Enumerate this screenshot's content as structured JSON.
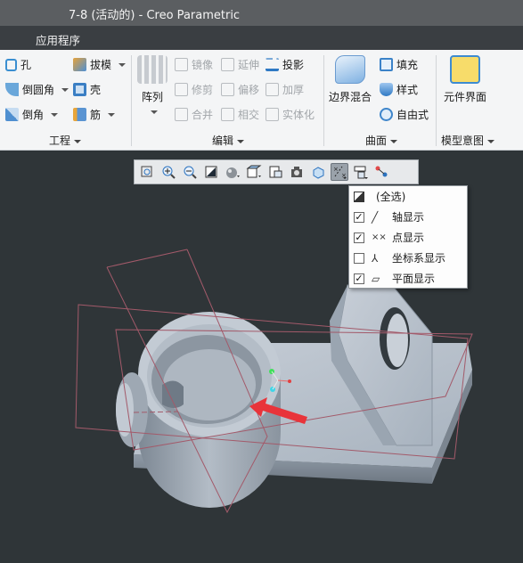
{
  "window": {
    "title": "7-8 (活动的) - Creo Parametric"
  },
  "menubar": {
    "applications": "应用程序"
  },
  "ribbon": {
    "engineering": {
      "hole": "孔",
      "draft": "拔模",
      "round": "倒圆角",
      "shell": "壳",
      "chamfer": "倒角",
      "rib": "筋",
      "group_label": "工程"
    },
    "editing": {
      "pattern": "阵列",
      "mirror": "镜像",
      "extend": "延伸",
      "project": "投影",
      "trim": "修剪",
      "offset": "偏移",
      "thicken": "加厚",
      "merge": "合并",
      "intersect": "相交",
      "solidify": "实体化",
      "group_label": "编辑"
    },
    "surfaces": {
      "boundary_blend": "边界混合",
      "fill": "填充",
      "style": "样式",
      "freestyle": "自由式",
      "group_label": "曲面"
    },
    "model_intent": {
      "component_interface": "元件界面",
      "group_label": "模型意图"
    }
  },
  "view_toolbar": {
    "buttons": [
      "refit-icon",
      "zoom-in-icon",
      "zoom-out-icon",
      "repaint-icon",
      "display-style-icon",
      "saved-orientations-icon",
      "view-manager-icon",
      "perspective-icon",
      "spin-center-icon",
      "datum-display-filters-icon",
      "annotation-display-icon",
      "model-tree-display-icon"
    ],
    "active": "datum-display-filters-icon"
  },
  "datum_filter_menu": {
    "items": [
      {
        "label": "(全选)",
        "checked": "partial"
      },
      {
        "label": "轴显示",
        "checked": true
      },
      {
        "label": "点显示",
        "checked": true
      },
      {
        "label": "坐标系显示",
        "checked": false
      },
      {
        "label": "平面显示",
        "checked": true
      }
    ]
  },
  "colors": {
    "viewport_bg": "#2f3538",
    "model": "#aeb8c3",
    "datum_plane": "#a35a6a",
    "annotation_arrow": "#e8343a"
  }
}
